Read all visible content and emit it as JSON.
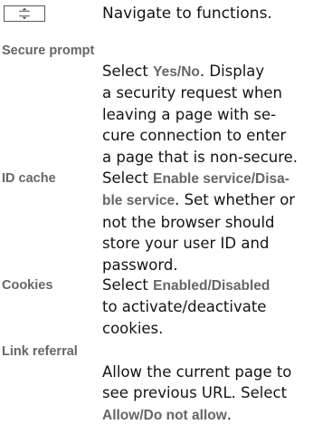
{
  "navigation": {
    "icon": "navigation-key-icon",
    "text": "Navigate to functions."
  },
  "settings": {
    "secure_prompt": {
      "term": "Secure prompt",
      "select_word": "Select",
      "option_yes": "Yes",
      "separator": "/",
      "option_no": "No",
      "after_options": ". Display",
      "line2": "a security request when",
      "line3": "leaving a page with se-",
      "line4": "cure connection to enter",
      "line5": "a page that is non-secure."
    },
    "id_cache": {
      "term": "ID cache",
      "select_word": "Select",
      "option_enable": "Enable service",
      "separator": "/",
      "option_disable_part1": "Disa-",
      "option_disable_part2": "ble service",
      "after_options": ". Set whether or",
      "line3": "not the browser should",
      "line4": "store your user ID and",
      "line5": "password."
    },
    "cookies": {
      "term": "Cookies",
      "select_word": "Select",
      "option_enabled": "Enabled",
      "separator": "/",
      "option_disabled": "Disabled",
      "line2": "to activate/deactivate",
      "line3": "cookies."
    },
    "link_referral": {
      "term": "Link referral",
      "line1": "Allow the current page to",
      "line2": "see previous URL. Select",
      "option_allow": "Allow",
      "separator": "/",
      "option_do_not_allow": "Do not allow",
      "period": "."
    }
  }
}
